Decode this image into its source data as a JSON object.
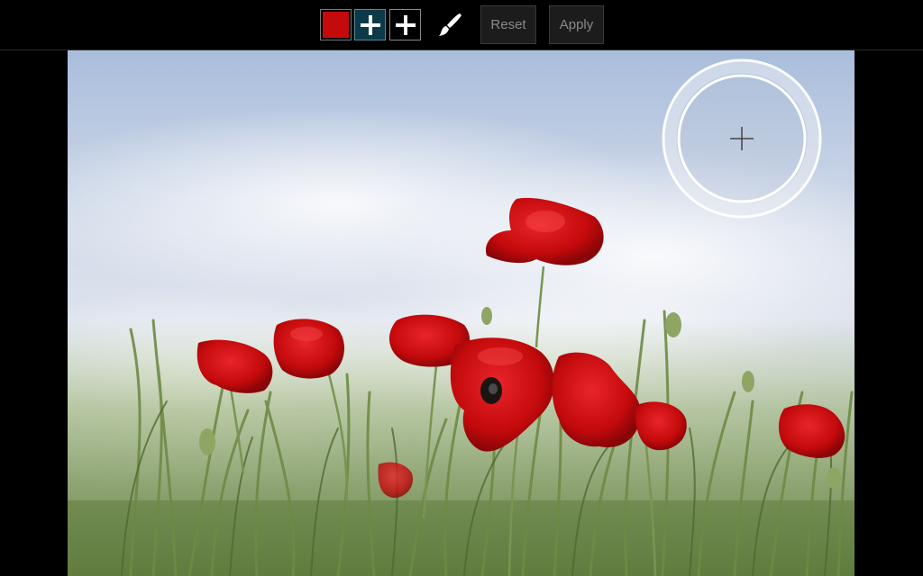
{
  "toolbar": {
    "color_swatch": {
      "color": "#c40a0c",
      "icon": "color-swatch"
    },
    "add_point_selected": {
      "icon": "plus-icon",
      "selected": true
    },
    "add_point": {
      "icon": "plus-icon",
      "selected": false
    },
    "brush": {
      "icon": "brush-icon"
    },
    "reset_label": "Reset",
    "apply_label": "Apply"
  },
  "photo": {
    "subject": "red-poppies-field",
    "accent_color": "#c40a0c"
  },
  "loupe": {
    "icon": "crosshair-icon"
  }
}
